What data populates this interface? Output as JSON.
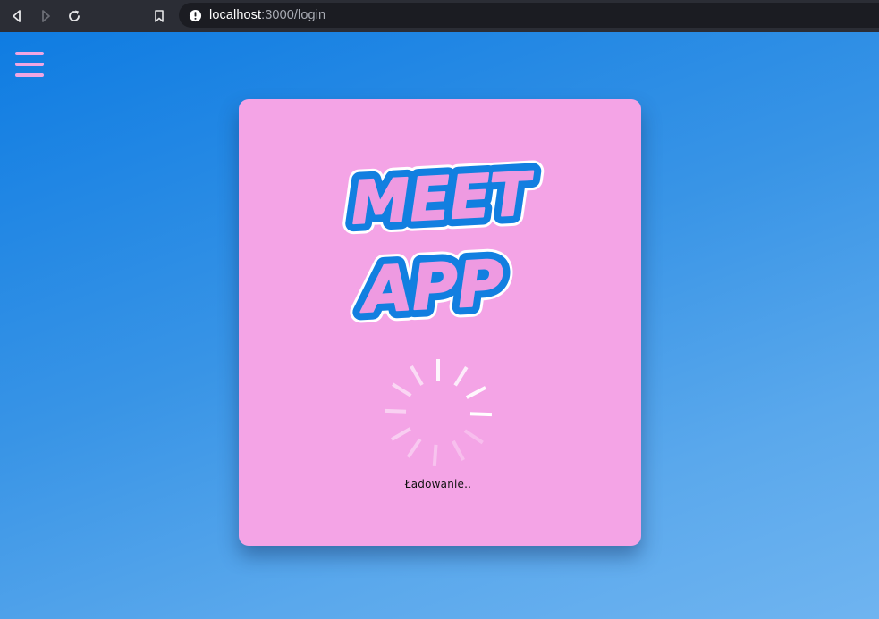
{
  "browser": {
    "url_host": "localhost",
    "url_path": ":3000/login",
    "icons": {
      "back": "arrow-left-icon",
      "forward": "arrow-right-icon",
      "reload": "reload-icon",
      "bookmark": "bookmark-icon",
      "site_info": "info-icon"
    }
  },
  "page": {
    "menu_icon": "hamburger-menu-icon",
    "colors": {
      "background_top": "#0f7ce2",
      "background_bottom": "#6fb4f0",
      "card": "#f4a4e6",
      "logo_fill": "#ee9ae1",
      "logo_outline": "#127fe0",
      "menu": "#f0a6e2"
    },
    "logo": {
      "line1": "MEET",
      "line2": "APP"
    },
    "loading": {
      "text": "Ładowanie..",
      "spinner_icon": "loading-spinner-icon"
    }
  }
}
